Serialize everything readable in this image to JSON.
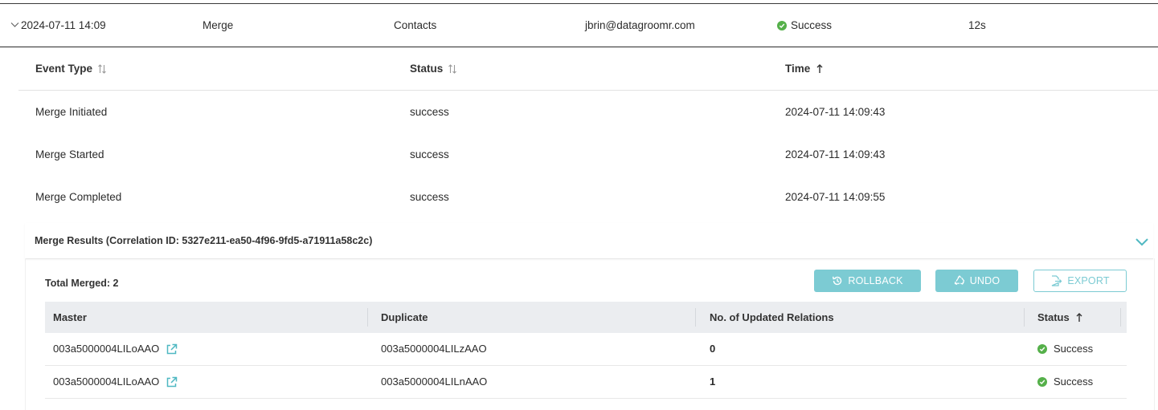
{
  "summary": {
    "datetime": "2024-07-11 14:09",
    "operation": "Merge",
    "object": "Contacts",
    "user": "jbrin@datagroomr.com",
    "status": "Success",
    "duration": "12s"
  },
  "events": {
    "columns": {
      "event_type": "Event Type",
      "status": "Status",
      "time": "Time"
    },
    "rows": [
      {
        "event_type": "Merge Initiated",
        "status": "success",
        "time": "2024-07-11 14:09:43"
      },
      {
        "event_type": "Merge Started",
        "status": "success",
        "time": "2024-07-11 14:09:43"
      },
      {
        "event_type": "Merge Completed",
        "status": "success",
        "time": "2024-07-11 14:09:55"
      }
    ]
  },
  "results": {
    "title": "Merge Results (Correlation ID: 5327e211-ea50-4f96-9fd5-a71911a58c2c)",
    "total_merged": "Total Merged: 2",
    "buttons": {
      "rollback": "ROLLBACK",
      "undo": "UNDO",
      "export": "EXPORT"
    },
    "columns": {
      "master": "Master",
      "duplicate": "Duplicate",
      "relations": "No. of Updated Relations",
      "status": "Status"
    },
    "rows": [
      {
        "master": "003a5000004LILoAAO",
        "duplicate": "003a5000004LILzAAO",
        "relations": "0",
        "status": "Success"
      },
      {
        "master": "003a5000004LILoAAO",
        "duplicate": "003a5000004LILnAAO",
        "relations": "1",
        "status": "Success"
      }
    ]
  },
  "colors": {
    "accent": "#7ccbd3",
    "success": "#55b04a",
    "header_bg": "#ebedf0"
  }
}
